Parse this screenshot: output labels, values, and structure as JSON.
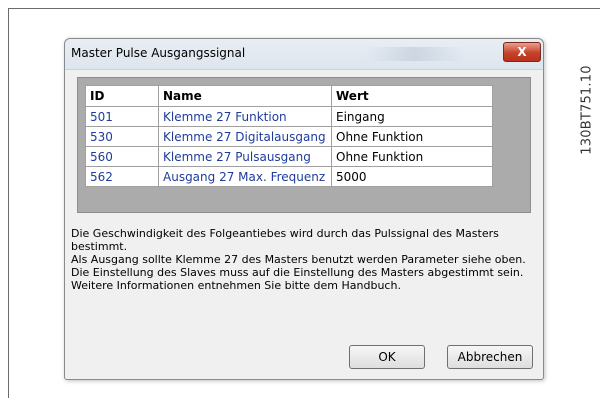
{
  "figure_code": "130BT751.10",
  "dialog": {
    "title": "Master Pulse Ausgangssignal",
    "close_glyph": "X",
    "columns": [
      "ID",
      "Name",
      "Wert"
    ],
    "rows": [
      {
        "id": "501",
        "name": "Klemme 27 Funktion",
        "value": "Eingang"
      },
      {
        "id": "530",
        "name": "Klemme 27 Digitalausgang",
        "value": "Ohne Funktion"
      },
      {
        "id": "560",
        "name": "Klemme 27 Pulsausgang",
        "value": "Ohne Funktion"
      },
      {
        "id": "562",
        "name": "Ausgang 27 Max. Frequenz",
        "value": "5000"
      }
    ],
    "description": [
      "Die Geschwindigkeit des Folgeantiebes wird durch das Pulssignal des Masters bestimmt.",
      "Als Ausgang sollte Klemme 27 des Masters benutzt werden Parameter siehe oben.",
      "Die Einstellung des Slaves muss auf die Einstellung des Masters abgestimmt sein.",
      "Weitere Informationen entnehmen Sie bitte dem Handbuch."
    ],
    "ok_label": "OK",
    "cancel_label": "Abbrechen"
  },
  "colors": {
    "link_text": "#1f3c9c",
    "close_button": "#c7412a",
    "table_panel": "#ababab"
  },
  "icons": {
    "close": "close-icon"
  }
}
